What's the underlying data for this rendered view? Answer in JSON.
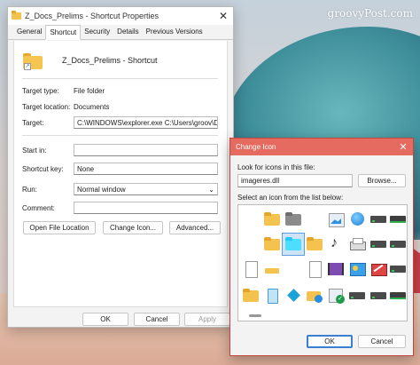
{
  "watermark": "groovyPost.com",
  "properties": {
    "title": "Z_Docs_Prelims - Shortcut Properties",
    "tabs": [
      "General",
      "Shortcut",
      "Security",
      "Details",
      "Previous Versions"
    ],
    "active_tab": "Shortcut",
    "shortcut_name": "Z_Docs_Prelims - Shortcut",
    "target_type_label": "Target type:",
    "target_type_value": "File folder",
    "target_location_label": "Target location:",
    "target_location_value": "Documents",
    "target_label": "Target:",
    "target_value": "C:\\WINDOWS\\explorer.exe C:\\Users\\groov\\Docum",
    "start_in_label": "Start in:",
    "start_in_value": "",
    "shortcut_key_label": "Shortcut key:",
    "shortcut_key_value": "None",
    "run_label": "Run:",
    "run_value": "Normal window",
    "comment_label": "Comment:",
    "comment_value": "",
    "buttons": {
      "open_file_location": "Open File Location",
      "change_icon": "Change Icon...",
      "advanced": "Advanced...",
      "ok": "OK",
      "cancel": "Cancel",
      "apply": "Apply"
    }
  },
  "change_icon": {
    "title": "Change Icon",
    "look_for_label": "Look for icons in this file:",
    "file_value": "imageres.dll",
    "browse_label": "Browse...",
    "select_label": "Select an icon from the list below:",
    "ok_label": "OK",
    "cancel_label": "Cancel",
    "icons": [
      "blank-icon",
      "folder-icon",
      "gray-folder-icon",
      "picture-frame-icon",
      "globe-monitor-icon",
      "drive-icon",
      "green-drive-icon",
      "blank-icon",
      "folder-icon",
      "teal-folder-icon",
      "folder-icon",
      "music-icon",
      "printer-icon",
      "drive-icon",
      "drive-icon",
      "document-icon",
      "tray-icon",
      "blank-icon",
      "picture-icon",
      "video-icon",
      "control-panel-icon",
      "blocked-drive-icon",
      "drive-icon",
      "folder-icon",
      "recycle-bin-icon",
      "cube-icon",
      "network-folder-icon",
      "checked-window-icon",
      "drive-icon",
      "drive-icon",
      "green-drive-icon"
    ],
    "selected_icon_index": 9
  }
}
